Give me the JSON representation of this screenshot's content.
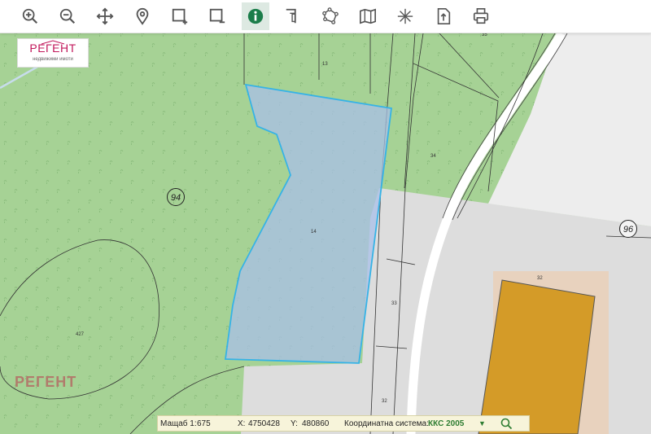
{
  "toolbar": {
    "tools": [
      {
        "name": "zoom-in-icon"
      },
      {
        "name": "zoom-out-icon"
      },
      {
        "name": "pan-icon"
      },
      {
        "name": "map-pin-icon"
      },
      {
        "name": "select-add-icon"
      },
      {
        "name": "select-remove-icon"
      },
      {
        "name": "info-icon",
        "active": true
      },
      {
        "name": "measure-distance-icon"
      },
      {
        "name": "measure-area-icon"
      },
      {
        "name": "map-layers-icon"
      },
      {
        "name": "coordinates-icon"
      },
      {
        "name": "export-icon"
      },
      {
        "name": "print-icon"
      }
    ]
  },
  "logo": {
    "text": "РЕГЕНТ",
    "subtitle": "недвижими имоти"
  },
  "watermark": "РЕГЕНТ",
  "map": {
    "plot_labels": [
      "13",
      "34",
      "14",
      "33",
      "32",
      "32",
      "427",
      "35"
    ],
    "block_labels": [
      "94",
      "96"
    ],
    "colors": {
      "forest": "#a6d295",
      "urban": "#dddddd",
      "road": "#ffffff",
      "building": "#d49b28",
      "building_yard": "#e8d2be",
      "selection_fill": "#a8bfe8",
      "selection_outline": "#36b3e6"
    }
  },
  "statusbar": {
    "scale_label": "Мащаб 1:",
    "scale_value": "675",
    "x_label": "X:",
    "x_value": "4750428",
    "y_label": "Y:",
    "y_value": "480860",
    "crs_label": "Координатна система:",
    "crs_value": "ККС 2005",
    "crs_dropdown_icon": "triangle-down-icon",
    "search_icon": "search-icon"
  }
}
